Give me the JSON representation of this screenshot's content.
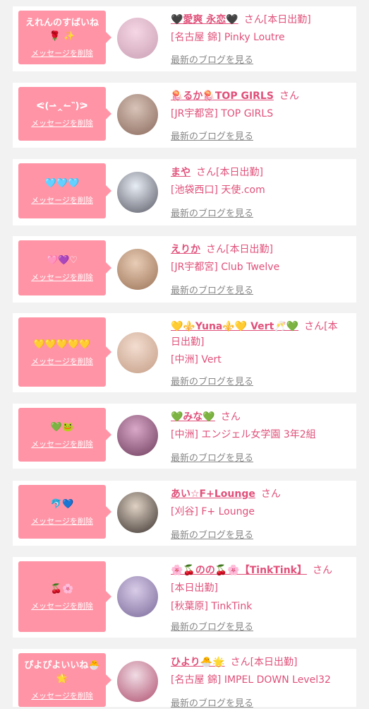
{
  "cards": [
    {
      "msg_lines": [
        "えれんのすばいね",
        "🌹 ✨"
      ],
      "delete_label": "メッセージを削除",
      "name_line1": "🖤愛爽 永恋🖤",
      "suffix": "さん[本日出勤]",
      "name_line2": "",
      "shop_lines": [
        "[名古屋 錦] Pinky Loutre"
      ],
      "blog_label": "最新のブログを見る",
      "avatar_colors": [
        "#f6d6e4",
        "#c9a0b4"
      ]
    },
    {
      "msg_lines": [
        "ᕙ(⇀‸↼‶)ᕗ"
      ],
      "delete_label": "メッセージを削除",
      "name_line1": "🪼るか🪼TOP GIRLS",
      "suffix": "さん",
      "name_line2": "",
      "shop_lines": [
        "[JR宇都宮] TOP GIRLS"
      ],
      "blog_label": "最新のブログを見る",
      "avatar_colors": [
        "#d8c3b8",
        "#8a6a5c"
      ]
    },
    {
      "msg_lines": [
        "🩵🩵🩵"
      ],
      "delete_label": "メッセージを削除",
      "name_line1": "まや",
      "suffix": "さん[本日出勤]",
      "name_line2": "",
      "shop_lines": [
        "[池袋西口] 天使.com"
      ],
      "blog_label": "最新のブログを見る",
      "avatar_colors": [
        "#e8eef5",
        "#5a5a66"
      ]
    },
    {
      "msg_lines": [
        "🩷💜♡"
      ],
      "delete_label": "メッセージを削除",
      "name_line1": "えりか",
      "suffix": "さん[本日出勤]",
      "name_line2": "",
      "shop_lines": [
        "[JR宇都宮] Club Twelve"
      ],
      "blog_label": "最新のブログを見る",
      "avatar_colors": [
        "#e9cdb6",
        "#9b7357"
      ]
    },
    {
      "msg_lines": [
        "💛💛💛💛💛"
      ],
      "delete_label": "メッセージを削除",
      "name_line1": "💛⚜️Yuna⚜️💛 Vert🥂💚",
      "suffix": "さん[本",
      "name_line2": "日出勤]",
      "shop_lines": [
        "[中洲] Vert"
      ],
      "blog_label": "最新のブログを見る",
      "avatar_colors": [
        "#f3ddd0",
        "#c49d86"
      ]
    },
    {
      "msg_lines": [
        "💚🐸"
      ],
      "delete_label": "メッセージを削除",
      "name_line1": "💚みな💚",
      "suffix": "さん",
      "name_line2": "",
      "shop_lines": [
        "[中洲] エンジェル女学園 3年2組"
      ],
      "blog_label": "最新のブログを見る",
      "avatar_colors": [
        "#d9a8c8",
        "#6e3c5c"
      ]
    },
    {
      "msg_lines": [
        "🐬💙"
      ],
      "delete_label": "メッセージを削除",
      "name_line1": "あい☆F+Lounge",
      "suffix": "さん",
      "name_line2": "",
      "shop_lines": [
        "[刈谷] F+ Lounge"
      ],
      "blog_label": "最新のブログを見る",
      "avatar_colors": [
        "#e0d2c4",
        "#3c3430"
      ]
    },
    {
      "msg_lines": [
        "🍒🌸"
      ],
      "delete_label": "メッセージを削除",
      "name_line1": "🌸🍒のの🍒🌸【TinkTink】",
      "suffix": "さん",
      "name_line2": "",
      "shop_lines": [
        "[本日出勤]",
        "[秋葉原] TinkTink"
      ],
      "blog_label": "最新のブログを見る",
      "avatar_colors": [
        "#d8cce8",
        "#7a6a9a"
      ]
    },
    {
      "msg_lines": [
        "ぴよぴよいいね🐣",
        "🌟"
      ],
      "delete_label": "メッセージを削除",
      "name_line1": "ひより🐣🌟",
      "suffix": "さん[本日出勤]",
      "name_line2": "",
      "shop_lines": [
        "[名古屋 錦] IMPEL DOWN Level32"
      ],
      "blog_label": "最新のブログを見る",
      "avatar_colors": [
        "#f0dce4",
        "#b05070"
      ]
    }
  ]
}
